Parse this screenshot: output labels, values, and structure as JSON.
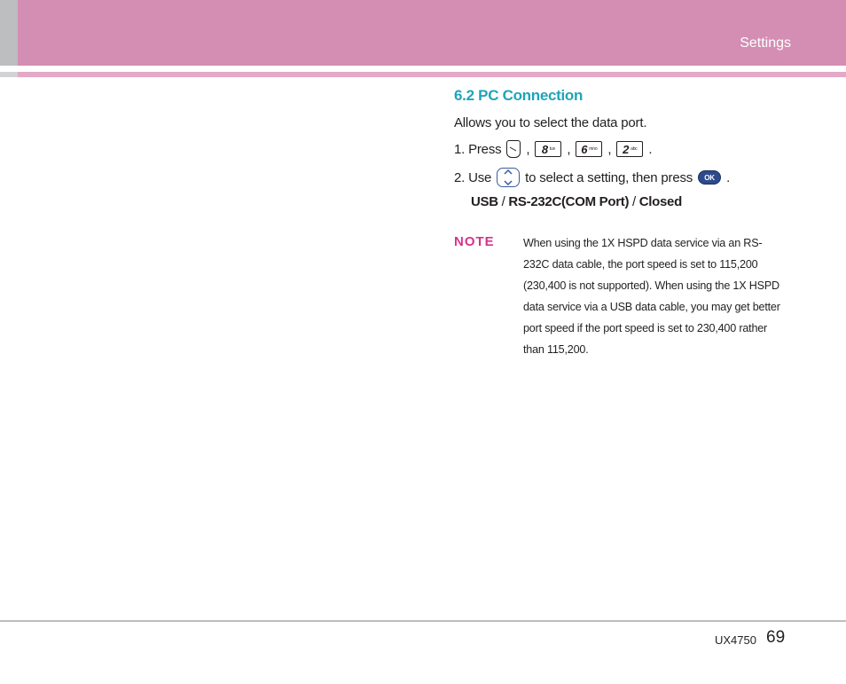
{
  "header": {
    "section": "Settings"
  },
  "content": {
    "title": "6.2 PC Connection",
    "intro": "Allows you to select the data port.",
    "step1": {
      "prefix": "1.  Press",
      "sep": ",",
      "end": ".",
      "keys": [
        {
          "num": "8",
          "letters": "tuv"
        },
        {
          "num": "6",
          "letters": "mno"
        },
        {
          "num": "2",
          "letters": "abc"
        }
      ]
    },
    "step2": {
      "prefix": "2.  Use",
      "middle": "to select a setting, then press",
      "end": ".",
      "ok_label": "OK"
    },
    "options": {
      "opt1": "USB",
      "sep": " / ",
      "opt2": "RS-232C(COM Port)",
      "opt3": "Closed"
    }
  },
  "note": {
    "label": "NOTE",
    "text": "When using the 1X HSPD data service via an RS-232C data cable, the port speed is set to 115,200 (230,400 is not supported). When using the 1X HSPD data service via a USB data cable, you may get better port speed if the port speed is set to 230,400 rather than 115,200."
  },
  "footer": {
    "model": "UX4750",
    "page": "69"
  },
  "icons": {
    "send": "send-key-icon",
    "nav": "navigation-key-icon",
    "ok": "ok-key-icon"
  },
  "colors": {
    "header_pink": "#d48eb4",
    "title_teal": "#1fa4b9",
    "note_magenta": "#d6338a"
  }
}
